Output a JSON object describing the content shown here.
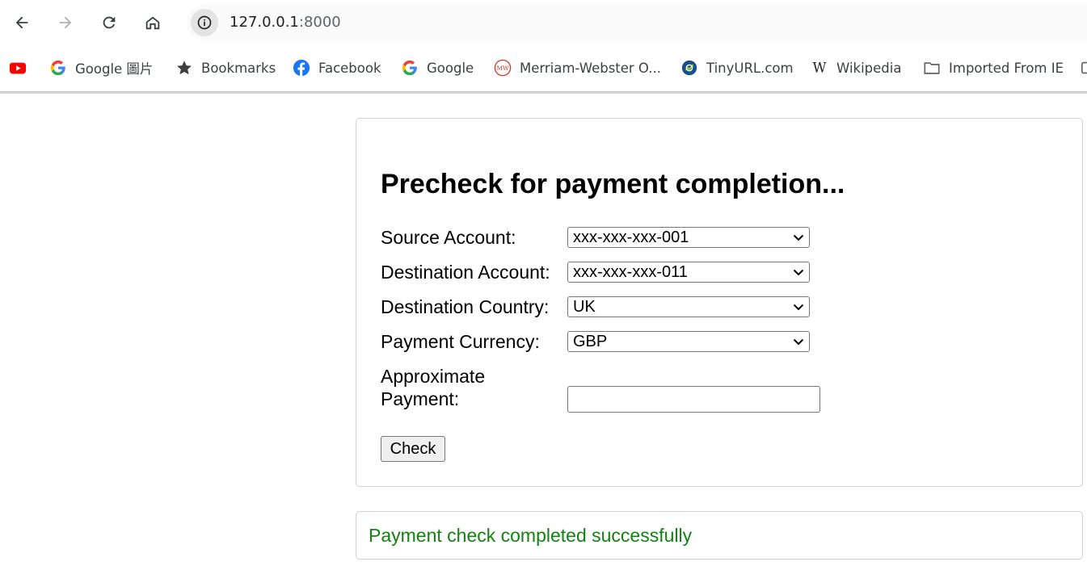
{
  "browser": {
    "url_host": "127.0.0.1",
    "url_port": ":8000",
    "bookmarks": [
      {
        "label": "",
        "icon": "youtube-icon"
      },
      {
        "label": "Google 圖片",
        "icon": "google-icon"
      },
      {
        "label": "Bookmarks",
        "icon": "star-icon"
      },
      {
        "label": "Facebook",
        "icon": "facebook-icon"
      },
      {
        "label": "Google",
        "icon": "google-icon"
      },
      {
        "label": "Merriam-Webster O...",
        "icon": "merriam-webster-icon"
      },
      {
        "label": "TinyURL.com",
        "icon": "tinyurl-icon"
      },
      {
        "label": "Wikipedia",
        "icon": "wikipedia-icon"
      },
      {
        "label": "Imported From IE",
        "icon": "folder-icon"
      }
    ]
  },
  "form": {
    "title": "Precheck for payment completion...",
    "source_account_label": "Source Account:",
    "source_account_value": "xxx-xxx-xxx-001",
    "destination_account_label": "Destination Account:",
    "destination_account_value": "xxx-xxx-xxx-011",
    "destination_country_label": "Destination Country:",
    "destination_country_value": "UK",
    "payment_currency_label": "Payment Currency:",
    "payment_currency_value": "GBP",
    "approx_payment_label_line1": "Approximate",
    "approx_payment_label_line2": "Payment:",
    "approx_payment_value": "",
    "check_button_label": "Check"
  },
  "result": {
    "message": "Payment check completed successfully",
    "color": "#128212"
  }
}
